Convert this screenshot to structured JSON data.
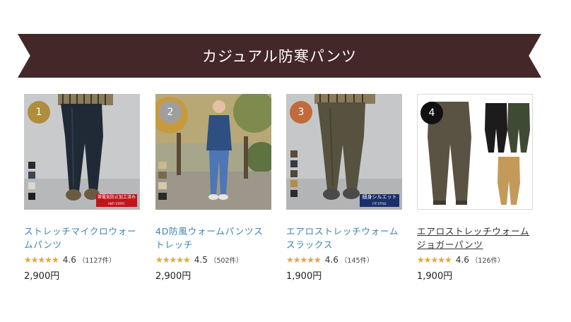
{
  "section": {
    "title": "カジュアル防寒パンツ"
  },
  "colors": {
    "banner_bg": "#442728",
    "link": "#3a84b6",
    "star": "#e9a72c",
    "rank_gold": "#b08d3a",
    "rank_silver": "#9e9e9e",
    "rank_bronze": "#c06a3d",
    "rank_4": "#111111"
  },
  "products": [
    {
      "rank": "1",
      "name": "ストレッチマイクロウォームパンツ",
      "stars": "★★★★★",
      "score": "4.6",
      "count": "（1127件）",
      "price": "2,900円",
      "badge": "帯電気防止加工済み",
      "badge_sub": "ANTI STATIC",
      "image_icon": "model-dark-jeans-photo"
    },
    {
      "rank": "2",
      "name": "4D防風ウォームパンツストレッチ",
      "stars": "★★★★★",
      "score": "4.5",
      "count": "（502件）",
      "price": "2,900円",
      "image_icon": "man-walking-park-photo"
    },
    {
      "rank": "3",
      "name": "エアロストレッチウォームスラックス",
      "stars": "★★★★★",
      "score": "4.6",
      "count": "（145件）",
      "price": "1,900円",
      "badge": "細身シルエット",
      "badge_sub": "FIT STYLE",
      "image_icon": "olive-slacks-photo"
    },
    {
      "rank": "4",
      "name": "エアロストレッチウォームジョガーパンツ",
      "stars": "★★★★★",
      "score": "4.6",
      "count": "（126件）",
      "price": "1,900円",
      "image_icon": "jogger-pants-colors-photo"
    }
  ]
}
